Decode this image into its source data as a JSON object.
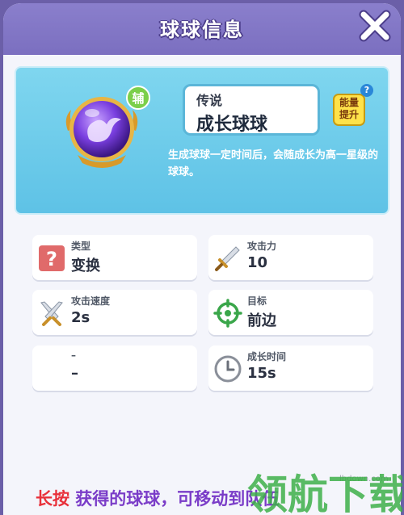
{
  "header": {
    "title": "球球信息"
  },
  "ball": {
    "badge": "辅",
    "rarity": "传说",
    "name": "成长球球",
    "energy_button": [
      "能量",
      "提升"
    ],
    "help": "?",
    "description": "生成球球一定时间后，会随成长为高一星级的球球。"
  },
  "stats": [
    {
      "label": "类型",
      "value": "变换",
      "icon": "question-icon"
    },
    {
      "label": "攻击力",
      "value": "10",
      "icon": "sword-icon"
    },
    {
      "label": "攻击速度",
      "value": "2s",
      "icon": "crossed-swords-icon"
    },
    {
      "label": "目标",
      "value": "前边",
      "icon": "target-icon"
    },
    {
      "label": "–",
      "value": "–",
      "icon": ""
    },
    {
      "label": "成长时间",
      "value": "15s",
      "icon": "clock-icon"
    }
  ],
  "hint": {
    "emphasis": "长按",
    "text": " 获得的球球，可移动到队伍"
  },
  "watermark": {
    "site": "lhdown.com",
    "logo_text": "领航下载"
  },
  "colors": {
    "header": "#7b6fc0",
    "card": "#5ec2e6",
    "badge": "#7bcf4a",
    "energy": "#ffe24a",
    "hint_emphasis": "#e8303a",
    "hint_text": "#7a3cc8"
  }
}
